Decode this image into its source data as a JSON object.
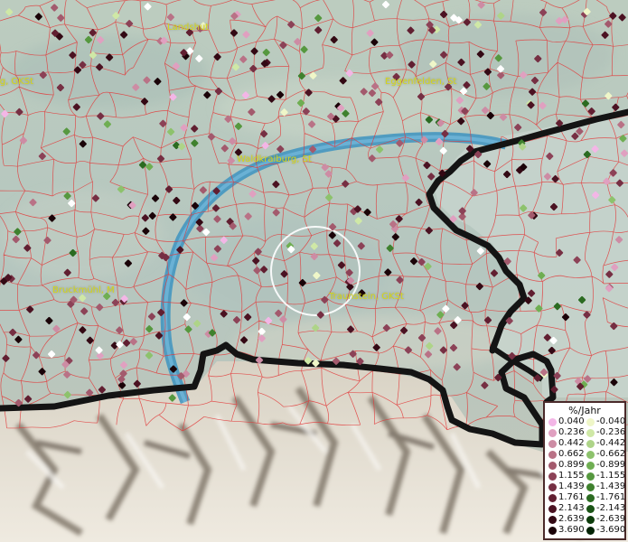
{
  "places": [
    {
      "name": "Landshut"
    },
    {
      "name": "Eggenfelden, St"
    },
    {
      "name": "Erding, GKSt"
    },
    {
      "name": "Waldkraiburg, St"
    },
    {
      "name": "Bruckmühl, M"
    },
    {
      "name": "Traunstein, GKSt"
    }
  ],
  "legend": {
    "title": "%/Jahr",
    "positive": [
      {
        "label": "0.040",
        "color": "#f3b6e6"
      },
      {
        "label": "0.236",
        "color": "#e0a0c0"
      },
      {
        "label": "0.442",
        "color": "#cd8ca4"
      },
      {
        "label": "0.662",
        "color": "#b97286"
      },
      {
        "label": "0.899",
        "color": "#a35a6d"
      },
      {
        "label": "1.155",
        "color": "#8c4257"
      },
      {
        "label": "1.439",
        "color": "#762f43"
      },
      {
        "label": "1.761",
        "color": "#611f31"
      },
      {
        "label": "2.143",
        "color": "#4b1222"
      },
      {
        "label": "2.639",
        "color": "#330914"
      },
      {
        "label": "3.690",
        "color": "#1a0308"
      }
    ],
    "negative": [
      {
        "label": "-0.040",
        "color": "#eff6c8"
      },
      {
        "label": "-0.236",
        "color": "#cfe8a6"
      },
      {
        "label": "-0.442",
        "color": "#aed488"
      },
      {
        "label": "-0.662",
        "color": "#8dc26c"
      },
      {
        "label": "-0.899",
        "color": "#6fae52"
      },
      {
        "label": "-1.155",
        "color": "#56983f"
      },
      {
        "label": "-1.439",
        "color": "#3f812e"
      },
      {
        "label": "-1.761",
        "color": "#2b6b21"
      },
      {
        "label": "-2.143",
        "color": "#1b5416"
      },
      {
        "label": "-2.639",
        "color": "#0e3d0c"
      },
      {
        "label": "-3.690",
        "color": "#042406"
      }
    ]
  },
  "overlays": {
    "boundary_color": "#141414",
    "river_color": "#3d93bf",
    "municipality_border_color": "#e23a3a",
    "highlight_circle_color": "#ffffff"
  }
}
